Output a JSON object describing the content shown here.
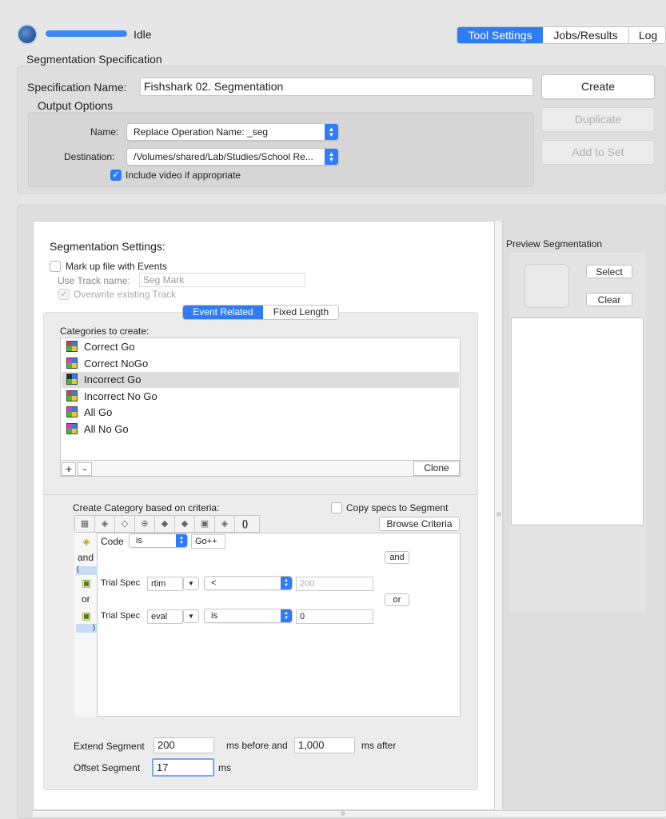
{
  "status": {
    "text": "Idle",
    "progress": 1.0
  },
  "tabs": [
    {
      "label": "Tool Settings",
      "active": true
    },
    {
      "label": "Jobs/Results",
      "active": false
    },
    {
      "label": "Log",
      "active": false
    }
  ],
  "spec": {
    "section_title": "Segmentation Specification",
    "name_label": "Specification Name:",
    "name_value": "Fishshark 02. Segmentation",
    "output_options_title": "Output Options",
    "output_name_label": "Name:",
    "output_name_value": "Replace Operation Name: _seg",
    "destination_label": "Destination:",
    "destination_value": "/Volumes/shared/Lab/Studies/School Re...",
    "include_video_label": "Include video if appropriate",
    "include_video_checked": true,
    "create_label": "Create",
    "duplicate_label": "Duplicate",
    "add_to_set_label": "Add to Set"
  },
  "settings": {
    "title": "Segmentation Settings:",
    "markup_label": "Mark up file with Events",
    "markup_checked": false,
    "use_track_label": "Use Track name:",
    "track_placeholder": "Seg Mark",
    "overwrite_label": "Overwrite existing Track",
    "mode_tabs": [
      {
        "label": "Event Related",
        "active": true
      },
      {
        "label": "Fixed Length",
        "active": false
      }
    ],
    "categories_label": "Categories to create:",
    "categories": [
      {
        "label": "Correct Go",
        "selected": false
      },
      {
        "label": "Correct NoGo",
        "selected": false
      },
      {
        "label": "Incorrect Go",
        "selected": true
      },
      {
        "label": "Incorrect No Go",
        "selected": false
      },
      {
        "label": "All Go",
        "selected": false
      },
      {
        "label": "All No Go",
        "selected": false
      }
    ],
    "add_symbol": "+",
    "remove_symbol": "-",
    "clone_label": "Clone",
    "criteria_label": "Create Category based on criteria:",
    "copy_specs_label": "Copy specs to Segment",
    "copy_specs_checked": false,
    "browse_label": "Browse Criteria",
    "criteria": {
      "code_label": "Code",
      "code_op": "is",
      "code_value": "Go++",
      "and_word": "and",
      "open_paren": "(",
      "close_paren": ")",
      "or_word": "or",
      "row1_label": "Trial Spec",
      "row1_field": "rtim",
      "row1_op": "<",
      "row1_value_placeholder": "200",
      "row2_label": "Trial Spec",
      "row2_field": "eval",
      "row2_op": "is",
      "row2_value": "0",
      "and_button": "and",
      "or_button": "or"
    },
    "extend_label": "Extend Segment",
    "extend_before": "200",
    "ms_before_label": "ms before and",
    "extend_after": "1,000",
    "ms_after_label": "ms after",
    "offset_label": "Offset Segment",
    "offset_value": "17",
    "ms_label": "ms"
  },
  "preview": {
    "title": "Preview Segmentation",
    "select_label": "Select",
    "clear_label": "Clear"
  },
  "colors": {
    "accent": "#2f7df6",
    "selected_row": "#dcdcdc",
    "paren_highlight": "#c9dcf7"
  }
}
